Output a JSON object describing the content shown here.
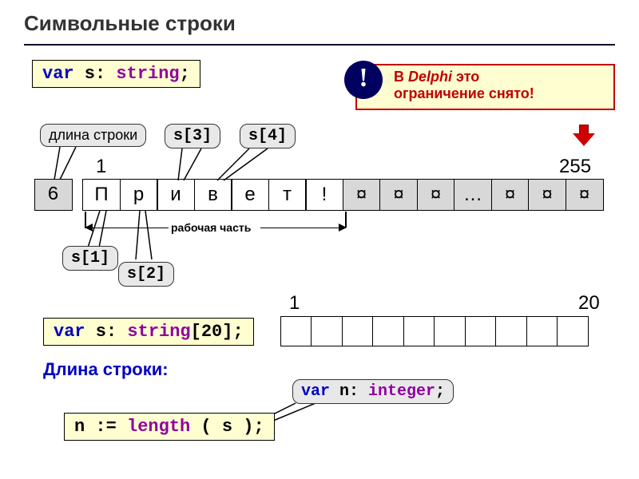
{
  "title": "Символьные строки",
  "decl1": {
    "var": "var",
    "s": " s: ",
    "type": "string",
    "semi": ";"
  },
  "note": {
    "excl": "!",
    "line1_prefix": "В ",
    "line1_em": "Delphi",
    "line1_suffix": " это",
    "line2": "ограничение снято!"
  },
  "callouts": {
    "len": "длина строки",
    "s1": "s[1]",
    "s2": "s[2]",
    "s3": "s[3]",
    "s4": "s[4]"
  },
  "indices": {
    "one": "1",
    "max": "255",
    "twenty_one": "1",
    "twenty": "20"
  },
  "cells": [
    "6",
    "П",
    "р",
    "и",
    "в",
    "е",
    "т",
    "!",
    "¤",
    "¤",
    "¤",
    "…",
    "¤",
    "¤",
    "¤"
  ],
  "working_part": "рабочая часть",
  "decl2": {
    "var": "var",
    "s": " s: ",
    "type": "string",
    "size": "[20]",
    "semi": ";"
  },
  "len_title": "Длина строки:",
  "len_expr": {
    "lhs": "n := ",
    "fn": "length",
    "args": " ( s );"
  },
  "decl_n": {
    "var": "var",
    "mid": " n: ",
    "type": "integer",
    "semi": ";"
  }
}
